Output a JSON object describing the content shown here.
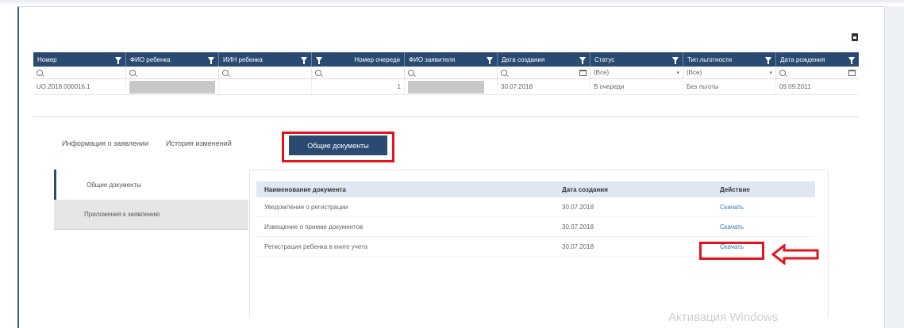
{
  "grid": {
    "columns": [
      {
        "label": "Номер",
        "width": 117
      },
      {
        "label": "ФИО ребенка",
        "width": 117
      },
      {
        "label": "ИИН ребенка",
        "width": 117
      },
      {
        "label": "Номер очереди",
        "width": 117
      },
      {
        "label": "ФИО заявителя",
        "width": 117
      },
      {
        "label": "Дата создания",
        "width": 117
      },
      {
        "label": "Статус",
        "width": 117
      },
      {
        "label": "Тип льготности",
        "width": 117
      },
      {
        "label": "Дата рождения",
        "width": 104
      }
    ],
    "filters": {
      "status_value": "(Все)",
      "benefit_value": "(Все)"
    },
    "row": {
      "number": "UO.2018.000016.1",
      "queue_number": "1",
      "created": "30.07.2018",
      "status": "В очереди",
      "benefit": "Без льготы",
      "birth_date": "09.09.2011"
    }
  },
  "tabs": {
    "info": "Информация о заявлении",
    "history": "История изменений",
    "common_docs": "Общие документы"
  },
  "sidemenu": {
    "common_docs": "Общие документы",
    "attachments": "Приложения к заявлению"
  },
  "docs": {
    "headers": {
      "name": "Наименование документа",
      "date": "Дата создания",
      "action": "Действие"
    },
    "rows": [
      {
        "name": "Уведомление о регистрации",
        "date": "30.07.2018",
        "action": "Скачать"
      },
      {
        "name": "Извещение о приеме документов",
        "date": "30.07.2018",
        "action": "Скачать"
      },
      {
        "name": "Регистрация ребенка в книге учета",
        "date": "30.07.2018",
        "action": "Скачать"
      }
    ]
  },
  "watermark": "Активация Windows",
  "colors": {
    "header_bg": "#2b4a72",
    "highlight_red": "#e3141e",
    "link_blue": "#2d7bbd"
  }
}
